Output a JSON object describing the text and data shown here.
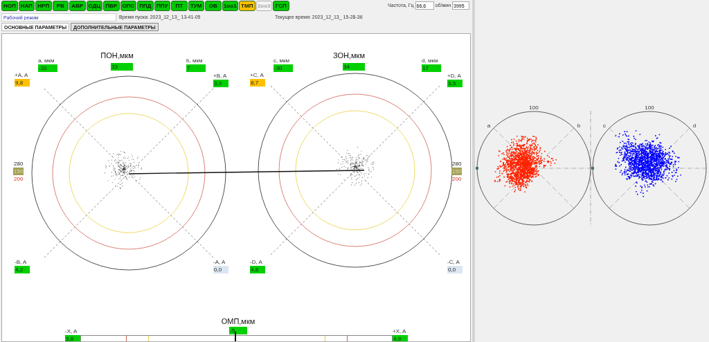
{
  "indicators": [
    {
      "label": "НОП",
      "warning": false,
      "disabled": false
    },
    {
      "label": "НАП",
      "warning": false,
      "disabled": false
    },
    {
      "label": "НРП",
      "warning": false,
      "disabled": false
    },
    {
      "label": "РВ",
      "warning": false,
      "disabled": false
    },
    {
      "label": "АВР",
      "warning": false,
      "disabled": false
    },
    {
      "label": "ОДЦ",
      "warning": false,
      "disabled": false
    },
    {
      "label": "ПВР",
      "warning": false,
      "disabled": false
    },
    {
      "label": "ОПС",
      "warning": false,
      "disabled": false
    },
    {
      "label": "ППД",
      "warning": false,
      "disabled": false
    },
    {
      "label": "ППУ",
      "warning": false,
      "disabled": false
    },
    {
      "label": "ПТ",
      "warning": false,
      "disabled": false
    },
    {
      "label": "ТУМ",
      "warning": false,
      "disabled": false
    },
    {
      "label": "ОВ",
      "warning": false,
      "disabled": false
    },
    {
      "label": "1оо1",
      "warning": false,
      "disabled": false
    },
    {
      "label": "ТМП",
      "warning": true,
      "disabled": false
    },
    {
      "label": "2оо3",
      "warning": false,
      "disabled": true
    },
    {
      "label": "ГСП",
      "warning": false,
      "disabled": false
    }
  ],
  "frequency": {
    "label": "Частота, Гц",
    "value": "66,6",
    "rpm_label": "об/мин",
    "rpm_value": "3995"
  },
  "mode_field": {
    "value": "Рабочий режим"
  },
  "start_time": "Время пуска: 2023_12_13_ 13-41-05",
  "current_time": "Текущее время: 2023_12_13_ 15-28-36",
  "tabs": [
    {
      "label": "ОСНОВНЫЕ ПАРАМЕТРЫ",
      "selected": true
    },
    {
      "label": "ДОПОЛНИТЕЛЬНЫЕ ПАРАМЕТРЫ",
      "selected": false
    }
  ],
  "orbits": [
    {
      "title": "ПОН,мкм",
      "value": "33",
      "color": "#00d000",
      "readouts": [
        {
          "label": "a, мкм",
          "value": "-33",
          "color": "#00d000"
        },
        {
          "label": "b, мкм",
          "value": "7",
          "color": "#00d000"
        },
        {
          "label": "+A, A",
          "value": "9,8",
          "color": "#ffc000"
        },
        {
          "label": "+B, A",
          "value": "3,9",
          "color": "#00d000"
        },
        {
          "label": "-B, A",
          "value": "4,2",
          "color": "#00d000"
        },
        {
          "label": "-A, A",
          "value": "0,0",
          "color": "#dce6f2"
        }
      ]
    },
    {
      "title": "ЗОН,мкм",
      "value": "34",
      "color": "#00d000",
      "readouts": [
        {
          "label": "c, мкм",
          "value": "-30",
          "color": "#00d000"
        },
        {
          "label": "d, мкм",
          "value": "17",
          "color": "#00d000"
        },
        {
          "label": "+C, A",
          "value": "8,7",
          "color": "#ffc000"
        },
        {
          "label": "+D, A",
          "value": "3,5",
          "color": "#00d000"
        },
        {
          "label": "-D, A",
          "value": "4,8",
          "color": "#00d000"
        },
        {
          "label": "-C, A",
          "value": "0,0",
          "color": "#dce6f2"
        }
      ]
    }
  ],
  "scales": [
    {
      "items": [
        {
          "text": "280",
          "kind": "plain"
        },
        {
          "text": "150",
          "kind": "box",
          "color": "#a3a05a"
        },
        {
          "text": "200",
          "kind": "alarm"
        }
      ]
    },
    {
      "items": [
        {
          "text": "280",
          "kind": "plain"
        },
        {
          "text": "150",
          "kind": "box",
          "color": "#a3a05a"
        },
        {
          "text": "200",
          "kind": "alarm"
        }
      ]
    }
  ],
  "axial": {
    "title": "ОМП,мкм",
    "value": "-5",
    "color": "#00d000",
    "level": 0.494,
    "left": {
      "label": "-X, A",
      "value": "3,8",
      "color": "#00d000"
    },
    "right": {
      "label": "+X, A",
      "value": "4,9",
      "color": "#00d000"
    }
  },
  "plots": [
    {
      "top_label": "100",
      "left_label": "a",
      "right_label": "b",
      "color": "#ff2200"
    },
    {
      "top_label": "100",
      "left_label": "c",
      "right_label": "d",
      "color": "#0000ff"
    }
  ]
}
